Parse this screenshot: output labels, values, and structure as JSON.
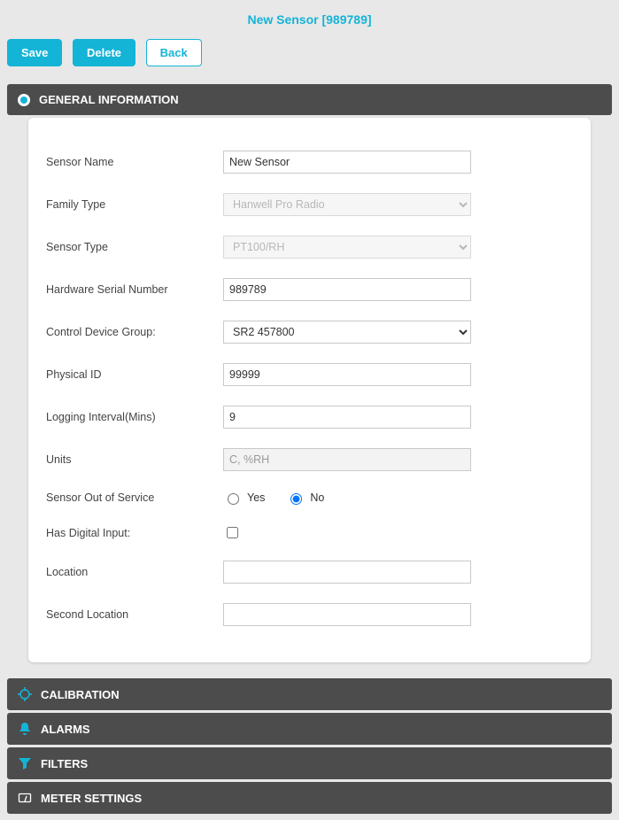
{
  "page_title": "New Sensor [989789]",
  "toolbar": {
    "save_label": "Save",
    "delete_label": "Delete",
    "back_label": "Back"
  },
  "sections": {
    "general": "GENERAL INFORMATION",
    "calibration": "CALIBRATION",
    "alarms": "ALARMS",
    "filters": "FILTERS",
    "meter": "METER SETTINGS"
  },
  "form": {
    "sensor_name": {
      "label": "Sensor Name",
      "value": "New Sensor"
    },
    "family_type": {
      "label": "Family Type",
      "value": "Hanwell Pro Radio"
    },
    "sensor_type": {
      "label": "Sensor Type",
      "value": "PT100/RH"
    },
    "hw_serial": {
      "label": "Hardware Serial Number",
      "value": "989789"
    },
    "ctrl_group": {
      "label": "Control Device Group:",
      "value": "SR2 457800"
    },
    "physical_id": {
      "label": "Physical ID",
      "value": "99999"
    },
    "log_interval": {
      "label": "Logging Interval(Mins)",
      "value": "9"
    },
    "units": {
      "label": "Units",
      "value": "C, %RH"
    },
    "out_of_service": {
      "label": "Sensor Out of Service",
      "yes": "Yes",
      "no": "No",
      "value": "No"
    },
    "digital_input": {
      "label": "Has Digital Input:",
      "checked": false
    },
    "location": {
      "label": "Location",
      "value": ""
    },
    "second_location": {
      "label": "Second Location",
      "value": ""
    }
  }
}
